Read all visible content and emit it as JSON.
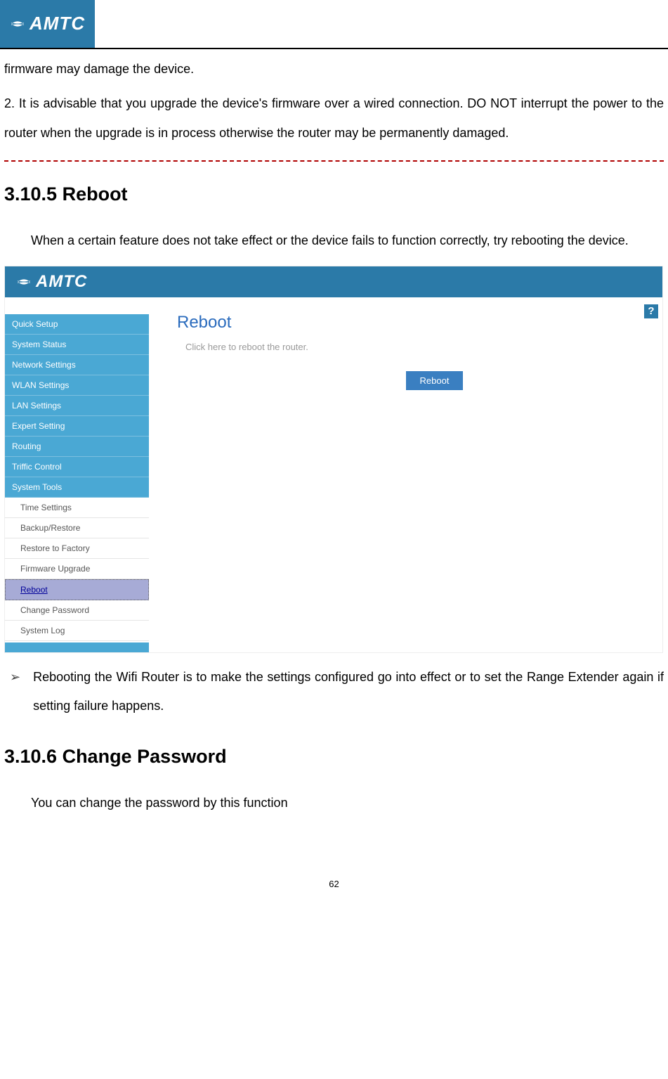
{
  "brand": "AMTC",
  "intro_para1": "firmware may damage the device.",
  "intro_para2": "2. It is advisable that you upgrade the device's firmware over a wired connection. DO NOT interrupt the power to the router when the upgrade is in process otherwise the router may be permanently damaged.",
  "section_reboot": {
    "heading": "3.10.5 Reboot",
    "body": "When a certain feature does not take effect or the device fails to function correctly, try rebooting the device.",
    "bullet_marker": "➢",
    "bullet_text": "Rebooting the Wifi Router is to make the settings configured go into effect or to set the Range Extender again if setting failure happens."
  },
  "screenshot": {
    "brand": "AMTC",
    "nav": [
      "Quick Setup",
      "System Status",
      "Network Settings",
      "WLAN Settings",
      "LAN Settings",
      "Expert Setting",
      "Routing",
      "Triffic Control",
      "System Tools"
    ],
    "sub_nav": [
      "Time Settings",
      "Backup/Restore",
      "Restore to Factory",
      "Firmware Upgrade",
      "Reboot",
      "Change Password",
      "System Log"
    ],
    "selected_sub": "Reboot",
    "content_title": "Reboot",
    "content_subtitle": "Click here to reboot the router.",
    "button_label": "Reboot",
    "help_symbol": "?"
  },
  "section_password": {
    "heading": "3.10.6 Change Password",
    "body": "You can change the password by this function"
  },
  "page_number": "62"
}
